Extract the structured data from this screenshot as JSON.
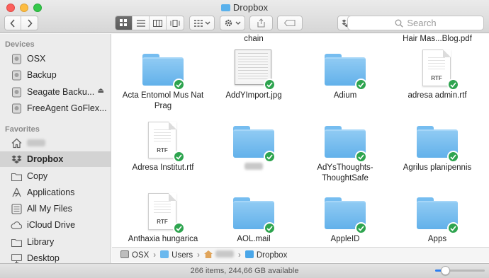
{
  "window": {
    "title": "Dropbox"
  },
  "toolbar": {
    "back_icon": "chevron-left-icon",
    "forward_icon": "chevron-right-icon",
    "search_placeholder": "Search"
  },
  "sidebar": {
    "devices_heading": "Devices",
    "devices": [
      {
        "label": "OSX",
        "icon": "disk-icon"
      },
      {
        "label": "Backup",
        "icon": "disk-icon"
      },
      {
        "label": "Seagate Backu...",
        "icon": "disk-icon"
      },
      {
        "label": "FreeAgent GoFlex...",
        "icon": "disk-icon"
      }
    ],
    "favorites_heading": "Favorites",
    "favorites": [
      {
        "label": "",
        "icon": "home-icon"
      },
      {
        "label": "Dropbox",
        "icon": "dropbox-icon",
        "selected": true
      },
      {
        "label": "Copy",
        "icon": "folder-icon"
      },
      {
        "label": "Applications",
        "icon": "applications-icon"
      },
      {
        "label": "All My Files",
        "icon": "all-files-icon"
      },
      {
        "label": "iCloud Drive",
        "icon": "cloud-icon"
      },
      {
        "label": "Library",
        "icon": "folder-icon"
      },
      {
        "label": "Desktop",
        "icon": "desktop-icon"
      }
    ]
  },
  "files": {
    "partial_top": [
      "chain",
      "Hair Mas...Blog.pdf"
    ],
    "items": [
      {
        "name": "Acta Entomol Mus Nat Prag",
        "kind": "folder"
      },
      {
        "name": "AddYImport.jpg",
        "kind": "image"
      },
      {
        "name": "Adium",
        "kind": "folder"
      },
      {
        "name": "adresa admin.rtf",
        "kind": "rtf"
      },
      {
        "name": "Adresa Institut.rtf",
        "kind": "rtf"
      },
      {
        "name": "",
        "kind": "folder"
      },
      {
        "name": "AdYsThoughts-ThoughtSafe",
        "kind": "folder"
      },
      {
        "name": "Agrilus planipennis",
        "kind": "folder"
      },
      {
        "name": "Anthaxia hungarica",
        "kind": "rtf"
      },
      {
        "name": "AOL.mail",
        "kind": "folder"
      },
      {
        "name": "AppleID",
        "kind": "folder"
      },
      {
        "name": "Apps",
        "kind": "folder"
      }
    ],
    "rtf_badge": "RTF"
  },
  "pathbar": {
    "crumbs": [
      "OSX",
      "Users",
      "",
      "Dropbox"
    ]
  },
  "status": {
    "text": "266 items, 244,66 GB available",
    "icon_size_fraction": 0.2
  },
  "colors": {
    "sync_ok": "#2ea44f",
    "folder": "#6ab8ee",
    "selection": "#d3d3d3"
  }
}
